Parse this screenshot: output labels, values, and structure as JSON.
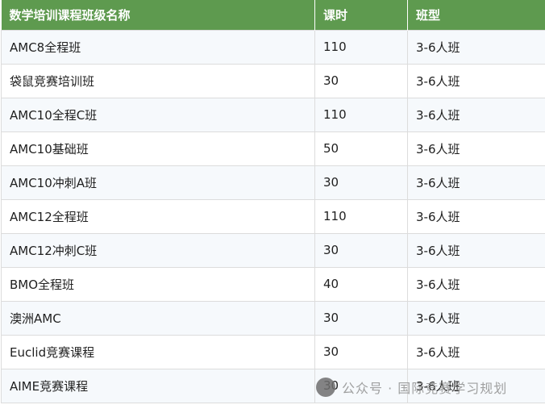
{
  "table": {
    "headers": [
      "数学培训课程班级名称",
      "课时",
      "班型"
    ],
    "rows": [
      [
        "AMC8全程班",
        "110",
        "3-6人班"
      ],
      [
        "袋鼠竞赛培训班",
        "30",
        "3-6人班"
      ],
      [
        "AMC10全程C班",
        "110",
        "3-6人班"
      ],
      [
        "AMC10基础班",
        "50",
        "3-6人班"
      ],
      [
        "AMC10冲刺A班",
        "30",
        "3-6人班"
      ],
      [
        "AMC12全程班",
        "110",
        "3-6人班"
      ],
      [
        "AMC12冲刺C班",
        "30",
        "3-6人班"
      ],
      [
        "BMO全程班",
        "40",
        "3-6人班"
      ],
      [
        "澳洲AMC",
        "30",
        "3-6人班"
      ],
      [
        "Euclid竞赛课程",
        "30",
        "3-6人班"
      ],
      [
        "AIME竞赛课程",
        "30",
        "3-6人班"
      ]
    ]
  },
  "watermark": {
    "text": "公众号 · 国际竞赛学习规划",
    "icon": "wechat-icon"
  }
}
